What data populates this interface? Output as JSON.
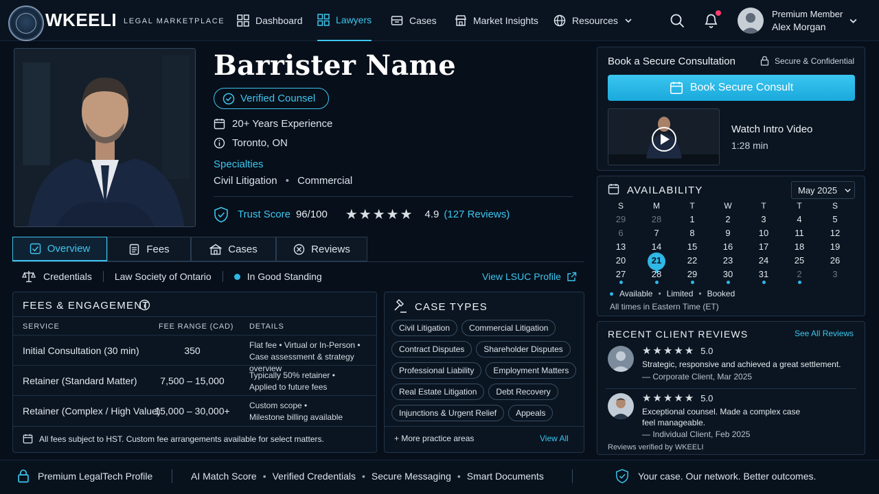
{
  "nav": {
    "brand": "WKEELI",
    "brand_sub": "LEGAL MARKETPLACE",
    "items": [
      {
        "label": "Dashboard",
        "icon": "grid-icon"
      },
      {
        "label": "Lawyers",
        "icon": "grid-icon",
        "active": true
      },
      {
        "label": "Cases",
        "icon": "briefcase-icon"
      },
      {
        "label": "Market Insights",
        "icon": "store-icon"
      },
      {
        "label": "Resources",
        "icon": "globe-icon"
      }
    ],
    "user_tier": "Premium Member",
    "user_name": "Alex Morgan"
  },
  "profile": {
    "name": "Barrister Name",
    "verified_label": "Verified Counsel",
    "experience": "20+ Years Experience",
    "location": "Toronto, ON",
    "specialties_label": "Specialties",
    "specialty_1": "Civil Litigation",
    "specialty_2": "Commercial",
    "trust_label": "Trust Score",
    "trust_value": "96/100",
    "rating": 4.9,
    "rating_text": "4.9",
    "reviews_link": "(127 Reviews)"
  },
  "tabs": [
    {
      "label": "Overview",
      "icon": "checklist-icon",
      "active": true
    },
    {
      "label": "Fees",
      "icon": "document-icon"
    },
    {
      "label": "Cases",
      "icon": "building-icon"
    },
    {
      "label": "Reviews",
      "icon": "close-circle-icon"
    }
  ],
  "credentials": {
    "label": "Credentials",
    "body": "Law Society of Ontario",
    "status": "In Good Standing",
    "link": "View LSUC Profile"
  },
  "fees": {
    "title": "FEES & ENGAGEMENT",
    "col_service": "SERVICE",
    "col_range": "FEE RANGE (CAD)",
    "col_details": "DETAILS",
    "rows": [
      {
        "service": "Initial Consultation (30 min)",
        "range": "350",
        "d1": "Flat fee • Virtual or In-Person •",
        "d2": "Case assessment & strategy overview"
      },
      {
        "service": "Retainer (Standard Matter)",
        "range": "7,500 – 15,000",
        "d1": "Typically 50% retainer •",
        "d2": "Applied to future fees"
      },
      {
        "service": "Retainer (Complex / High Value)",
        "range": "15,000 – 30,000+",
        "d1": "Custom scope •",
        "d2": "Milestone billing available"
      }
    ],
    "note": "All fees subject to HST. Custom fee arrangements available for select matters."
  },
  "case_types": {
    "title": "CASE TYPES",
    "chips": [
      "Civil Litigation",
      "Commercial Litigation",
      "Contract Disputes",
      "Shareholder Disputes",
      "Professional Liability",
      "Employment Matters",
      "Real Estate Litigation",
      "Debt Recovery",
      "Injunctions & Urgent Relief",
      "Appeals"
    ],
    "more": "+ More practice areas",
    "view_all": "View All"
  },
  "booking": {
    "title": "Book a Secure Consultation",
    "secure": "Secure & Confidential",
    "button": "Book Secure Consult",
    "video_title": "Watch Intro Video",
    "video_len": "1:28 min"
  },
  "availability": {
    "title": "AVAILABILITY",
    "month": "May 2025",
    "weekdays": [
      "S",
      "M",
      "T",
      "W",
      "T",
      "T",
      "S"
    ],
    "weeks": [
      [
        "29",
        "28",
        "1",
        "2",
        "3",
        "4",
        "5"
      ],
      [
        "6",
        "7",
        "8",
        "9",
        "10",
        "11",
        "12"
      ],
      [
        "13",
        "14",
        "15",
        "16",
        "17",
        "18",
        "19"
      ],
      [
        "20",
        "21",
        "22",
        "23",
        "24",
        "25",
        "26"
      ],
      [
        "27",
        "28",
        "29",
        "30",
        "31",
        "2",
        "3"
      ]
    ],
    "selected_day": "21",
    "legend_available": "Available",
    "legend_limited": "Limited",
    "legend_booked": "Booked",
    "tz_note": "All times in Eastern Time (ET)"
  },
  "reviews": {
    "title": "RECENT CLIENT REVIEWS",
    "see_all": "See All Reviews",
    "items": [
      {
        "rating": "5.0",
        "text1": "Strategic, responsive and achieved a great settlement.",
        "text2": "",
        "author": "— Corporate Client, Mar 2025"
      },
      {
        "rating": "5.0",
        "text1": "Exceptional counsel. Made a complex case",
        "text2": "feel manageable.",
        "author": "— Individual Client, Feb 2025"
      }
    ],
    "verified": "Reviews verified by WKEELI"
  },
  "footer": {
    "premium": "Premium LegalTech Profile",
    "f1": "AI Match Score",
    "f2": "Verified Credentials",
    "f3": "Secure Messaging",
    "f4": "Smart Documents",
    "tagline": "Your case. Our network. Better outcomes."
  },
  "colors": {
    "accent": "#3ec6ee",
    "background": "#070f1a",
    "notification": "#ff3d6e"
  }
}
